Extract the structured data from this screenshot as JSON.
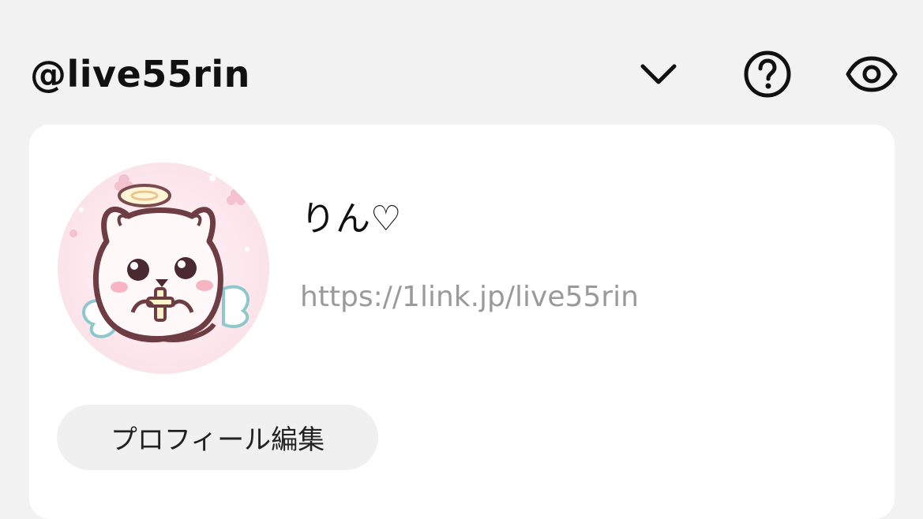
{
  "header": {
    "handle": "@live55rin",
    "icons": {
      "dropdown": "chevron-down-icon",
      "help": "help-circle-icon",
      "preview": "eye-icon"
    }
  },
  "profile": {
    "display_name": "りん♡",
    "url": "https://1link.jp/live55rin",
    "edit_button_label": "プロフィール編集",
    "avatar": "angel-bunny-avatar"
  },
  "colors": {
    "background": "#f2f2f2",
    "card": "#ffffff",
    "url_text": "#9a9a9a",
    "button_bg": "#f0f0f0"
  }
}
